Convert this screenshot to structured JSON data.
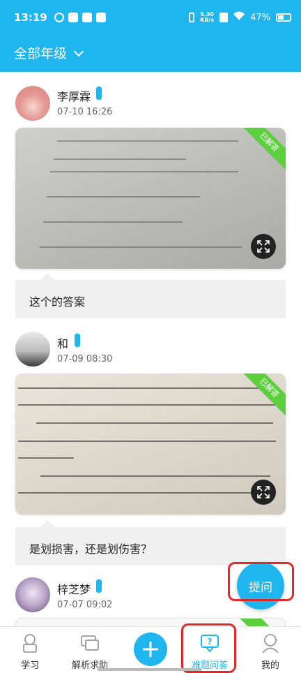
{
  "status_bar": {
    "time": "13:19",
    "net_speed_value": "5.30",
    "net_speed_unit": "KB/s",
    "battery": "47%"
  },
  "header": {
    "grade_filter_label": "全部年级"
  },
  "posts": [
    {
      "user": "李厚霖",
      "time": "07-10 16:26",
      "badge": "已解答",
      "question": "这个的答案"
    },
    {
      "user": "和",
      "time": "07-09 08:30",
      "badge": "已解答",
      "question": "是划损害，还是划伤害？"
    },
    {
      "user": "梓芝梦",
      "time": "07-07 09:02",
      "badge": "已解答"
    }
  ],
  "fab": {
    "ask_label": "提问"
  },
  "tabbar": {
    "items": [
      {
        "label": "学习",
        "icon": "study-icon"
      },
      {
        "label": "解析求助",
        "icon": "help-chat-icon"
      },
      {
        "label": "",
        "icon": "plus-icon"
      },
      {
        "label": "难题问答",
        "icon": "question-chat-icon"
      },
      {
        "label": "我的",
        "icon": "profile-icon"
      }
    ],
    "active_index": 3
  },
  "colors": {
    "brand": "#1fb6f0",
    "solved_ribbon": "#5ccf3e",
    "highlight": "#e02a2a"
  }
}
